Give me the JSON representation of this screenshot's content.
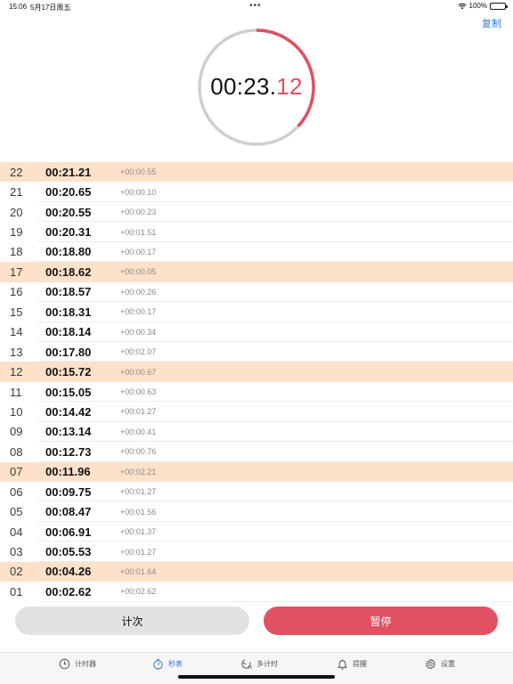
{
  "status_bar": {
    "time": "15:06",
    "date": "5月17日周五",
    "dots": "•••",
    "battery": "100%"
  },
  "header": {
    "copy_label": "复制"
  },
  "timer": {
    "main": "00:23.",
    "centis": "12",
    "progress": 0.37,
    "accent_color": "#e05062",
    "track_color": "#cfcfcf"
  },
  "laps": [
    {
      "num": "22",
      "time": "00:21.21",
      "diff": "+00:00.55",
      "highlight": true
    },
    {
      "num": "21",
      "time": "00:20.65",
      "diff": "+00:00.10",
      "highlight": false
    },
    {
      "num": "20",
      "time": "00:20.55",
      "diff": "+00:00.23",
      "highlight": false
    },
    {
      "num": "19",
      "time": "00:20.31",
      "diff": "+00:01.51",
      "highlight": false
    },
    {
      "num": "18",
      "time": "00:18.80",
      "diff": "+00:00.17",
      "highlight": false
    },
    {
      "num": "17",
      "time": "00:18.62",
      "diff": "+00:00.05",
      "highlight": true
    },
    {
      "num": "16",
      "time": "00:18.57",
      "diff": "+00:00.26",
      "highlight": false
    },
    {
      "num": "15",
      "time": "00:18.31",
      "diff": "+00:00.17",
      "highlight": false
    },
    {
      "num": "14",
      "time": "00:18.14",
      "diff": "+00:00.34",
      "highlight": false
    },
    {
      "num": "13",
      "time": "00:17.80",
      "diff": "+00:02.07",
      "highlight": false
    },
    {
      "num": "12",
      "time": "00:15.72",
      "diff": "+00:00.67",
      "highlight": true
    },
    {
      "num": "11",
      "time": "00:15.05",
      "diff": "+00:00.63",
      "highlight": false
    },
    {
      "num": "10",
      "time": "00:14.42",
      "diff": "+00:01.27",
      "highlight": false
    },
    {
      "num": "09",
      "time": "00:13.14",
      "diff": "+00:00.41",
      "highlight": false
    },
    {
      "num": "08",
      "time": "00:12.73",
      "diff": "+00:00.76",
      "highlight": false
    },
    {
      "num": "07",
      "time": "00:11.96",
      "diff": "+00:02.21",
      "highlight": true
    },
    {
      "num": "06",
      "time": "00:09.75",
      "diff": "+00:01.27",
      "highlight": false
    },
    {
      "num": "05",
      "time": "00:08.47",
      "diff": "+00:01.56",
      "highlight": false
    },
    {
      "num": "04",
      "time": "00:06.91",
      "diff": "+00:01.37",
      "highlight": false
    },
    {
      "num": "03",
      "time": "00:05.53",
      "diff": "+00:01.27",
      "highlight": false
    },
    {
      "num": "02",
      "time": "00:04.26",
      "diff": "+00:01.64",
      "highlight": true
    },
    {
      "num": "01",
      "time": "00:02.62",
      "diff": "+00:02.62",
      "highlight": false
    }
  ],
  "buttons": {
    "lap_label": "计次",
    "pause_label": "暂停"
  },
  "tabs": [
    {
      "label": "计时器",
      "icon": "clock-icon",
      "active": false
    },
    {
      "label": "秒表",
      "icon": "stopwatch-icon",
      "active": true
    },
    {
      "label": "多计时",
      "icon": "multi-timer-icon",
      "active": false
    },
    {
      "label": "提醒",
      "icon": "bell-icon",
      "active": false
    },
    {
      "label": "设置",
      "icon": "gear-icon",
      "active": false
    }
  ]
}
